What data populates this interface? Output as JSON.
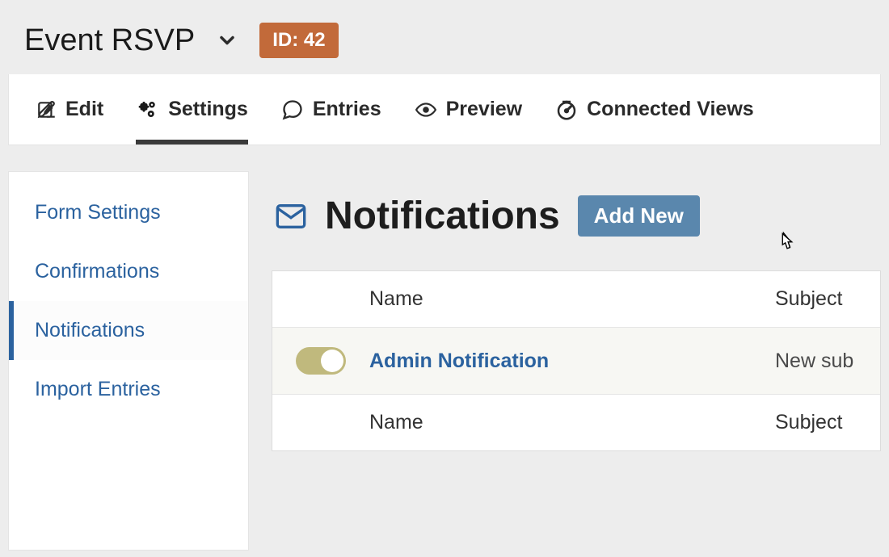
{
  "header": {
    "title": "Event RSVP",
    "id_label": "ID: 42"
  },
  "tabs": [
    {
      "label": "Edit",
      "icon": "edit-icon",
      "active": false
    },
    {
      "label": "Settings",
      "icon": "gears-icon",
      "active": true
    },
    {
      "label": "Entries",
      "icon": "chat-bubble-icon",
      "active": false
    },
    {
      "label": "Preview",
      "icon": "eye-icon",
      "active": false
    },
    {
      "label": "Connected Views",
      "icon": "gauge-icon",
      "active": false
    }
  ],
  "sidebar": {
    "items": [
      {
        "label": "Form Settings",
        "active": false
      },
      {
        "label": "Confirmations",
        "active": false
      },
      {
        "label": "Notifications",
        "active": true
      },
      {
        "label": "Import Entries",
        "active": false
      }
    ]
  },
  "page": {
    "heading": "Notifications",
    "add_new_label": "Add New"
  },
  "table": {
    "columns": {
      "name": "Name",
      "subject": "Subject"
    },
    "rows": [
      {
        "name": "Admin Notification",
        "subject": "New sub",
        "enabled": true
      }
    ],
    "footer": {
      "name": "Name",
      "subject": "Subject"
    }
  }
}
